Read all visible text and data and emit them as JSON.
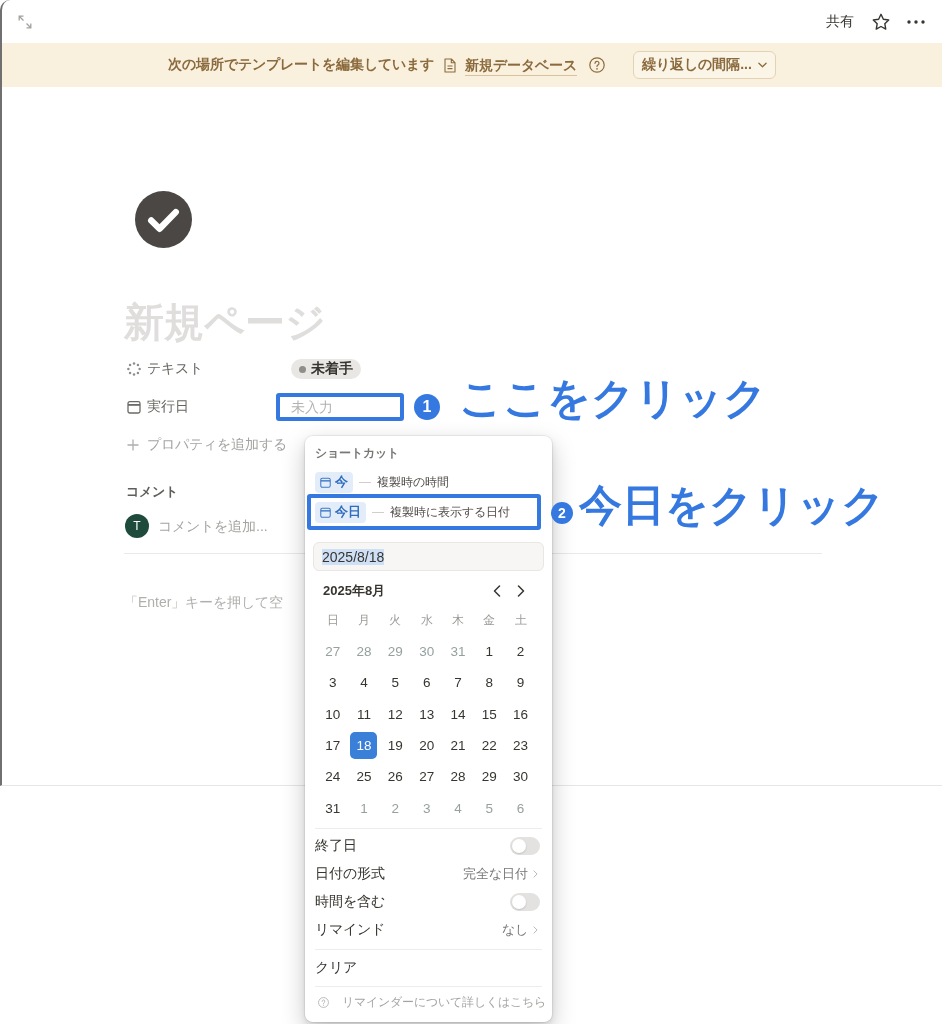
{
  "topbar": {
    "share": "共有"
  },
  "banner": {
    "text": "次の場所でテンプレートを編集しています",
    "link": "新規データベース",
    "dropdown": "繰り返しの間隔..."
  },
  "page": {
    "title": {
      "placeholder": "新規ページ"
    },
    "properties": [
      {
        "kind": "status",
        "label": "テキスト",
        "value": "未着手",
        "highlighted": false
      },
      {
        "kind": "date",
        "label": "実行日",
        "placeholder": "未入力",
        "highlighted": true,
        "annotation": {
          "number": "1",
          "text": "ここをクリック"
        }
      }
    ],
    "add_property": "プロパティを追加する",
    "comments": {
      "heading": "コメント",
      "avatar": "T",
      "placeholder": "コメントを追加..."
    },
    "block": {
      "placeholder": "「Enter」キーを押して空"
    }
  },
  "date_popover": {
    "shortcuts_heading": "ショートカット",
    "shortcuts": [
      {
        "label": "今",
        "dash": "—",
        "description": "複製時の時間",
        "highlighted": false
      },
      {
        "label": "今日",
        "dash": "—",
        "description": "複製時に表示する日付",
        "highlighted": true,
        "annotation": {
          "number": "2",
          "text": "今日をクリック"
        }
      }
    ],
    "date_input": {
      "value": "2025/8/18",
      "text_selected": true
    },
    "calendar": {
      "month": "2025年8月",
      "weekdays": [
        "日",
        "月",
        "火",
        "水",
        "木",
        "金",
        "土"
      ],
      "weeks": [
        [
          {
            "day": "27",
            "outside": true,
            "selected": false
          },
          {
            "day": "28",
            "outside": true,
            "selected": false
          },
          {
            "day": "29",
            "outside": true,
            "selected": false
          },
          {
            "day": "30",
            "outside": true,
            "selected": false
          },
          {
            "day": "31",
            "outside": true,
            "selected": false
          },
          {
            "day": "1",
            "outside": false,
            "selected": false
          },
          {
            "day": "2",
            "outside": false,
            "selected": false
          }
        ],
        [
          {
            "day": "3",
            "outside": false,
            "selected": false
          },
          {
            "day": "4",
            "outside": false,
            "selected": false
          },
          {
            "day": "5",
            "outside": false,
            "selected": false
          },
          {
            "day": "6",
            "outside": false,
            "selected": false
          },
          {
            "day": "7",
            "outside": false,
            "selected": false
          },
          {
            "day": "8",
            "outside": false,
            "selected": false
          },
          {
            "day": "9",
            "outside": false,
            "selected": false
          }
        ],
        [
          {
            "day": "10",
            "outside": false,
            "selected": false
          },
          {
            "day": "11",
            "outside": false,
            "selected": false
          },
          {
            "day": "12",
            "outside": false,
            "selected": false
          },
          {
            "day": "13",
            "outside": false,
            "selected": false
          },
          {
            "day": "14",
            "outside": false,
            "selected": false
          },
          {
            "day": "15",
            "outside": false,
            "selected": false
          },
          {
            "day": "16",
            "outside": false,
            "selected": false
          }
        ],
        [
          {
            "day": "17",
            "outside": false,
            "selected": false
          },
          {
            "day": "18",
            "outside": false,
            "selected": true
          },
          {
            "day": "19",
            "outside": false,
            "selected": false
          },
          {
            "day": "20",
            "outside": false,
            "selected": false
          },
          {
            "day": "21",
            "outside": false,
            "selected": false
          },
          {
            "day": "22",
            "outside": false,
            "selected": false
          },
          {
            "day": "23",
            "outside": false,
            "selected": false
          }
        ],
        [
          {
            "day": "24",
            "outside": false,
            "selected": false
          },
          {
            "day": "25",
            "outside": false,
            "selected": false
          },
          {
            "day": "26",
            "outside": false,
            "selected": false
          },
          {
            "day": "27",
            "outside": false,
            "selected": false
          },
          {
            "day": "28",
            "outside": false,
            "selected": false
          },
          {
            "day": "29",
            "outside": false,
            "selected": false
          },
          {
            "day": "30",
            "outside": false,
            "selected": false
          }
        ],
        [
          {
            "day": "31",
            "outside": false,
            "selected": false
          },
          {
            "day": "1",
            "outside": true,
            "selected": false
          },
          {
            "day": "2",
            "outside": true,
            "selected": false
          },
          {
            "day": "3",
            "outside": true,
            "selected": false
          },
          {
            "day": "4",
            "outside": true,
            "selected": false
          },
          {
            "day": "5",
            "outside": true,
            "selected": false
          },
          {
            "day": "6",
            "outside": true,
            "selected": false
          }
        ]
      ]
    },
    "settings": [
      {
        "kind": "toggle",
        "label": "終了日",
        "on": false
      },
      {
        "kind": "menu",
        "label": "日付の形式",
        "value": "完全な日付"
      },
      {
        "kind": "toggle",
        "label": "時間を含む",
        "on": false
      },
      {
        "kind": "menu",
        "label": "リマインド",
        "value": "なし"
      }
    ],
    "clear": "クリア",
    "help": "リマインダーについて詳しくはこちら"
  }
}
